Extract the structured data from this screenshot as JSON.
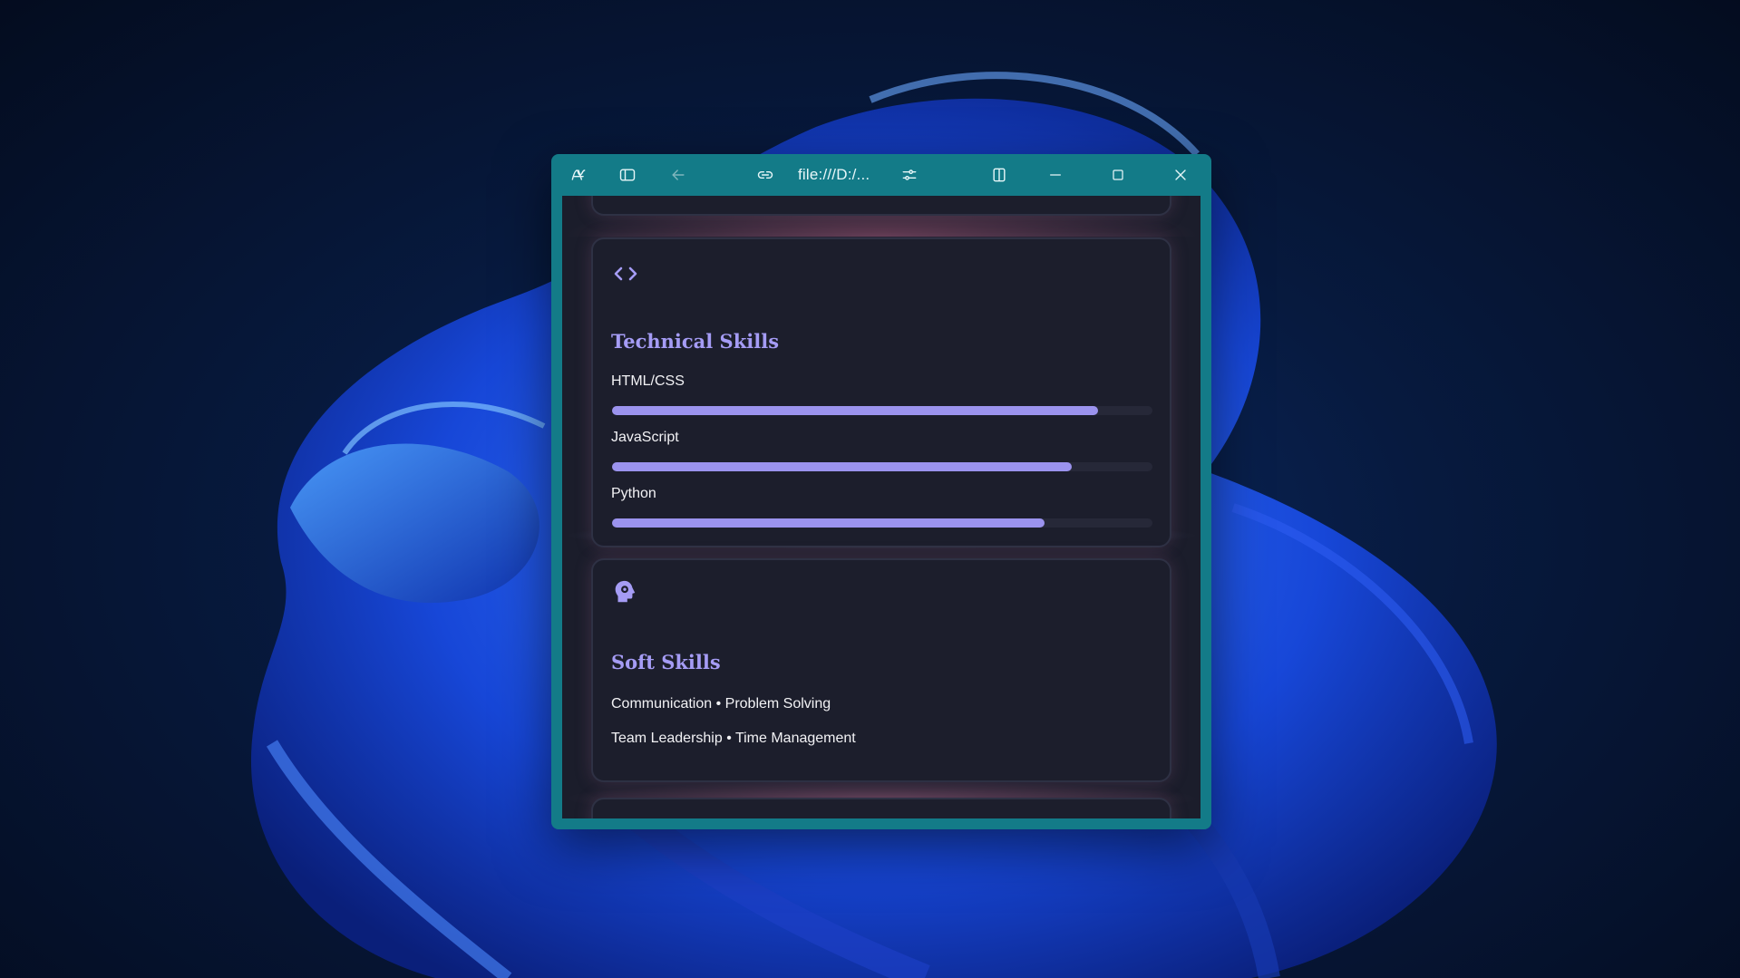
{
  "browser": {
    "address": "file:///D:/...",
    "accent_color": "#137b88"
  },
  "skills": {
    "technical": {
      "title": "Technical Skills",
      "icon": "code-icon",
      "items": [
        {
          "label": "HTML/CSS",
          "level": 0.9
        },
        {
          "label": "JavaScript",
          "level": 0.85
        },
        {
          "label": "Python",
          "level": 0.8
        }
      ]
    },
    "soft": {
      "title": "Soft Skills",
      "icon": "head-gear-icon",
      "lines": [
        "Communication • Problem Solving",
        "Team Leadership • Time Management"
      ]
    },
    "accent_color": "#a59cf5"
  }
}
